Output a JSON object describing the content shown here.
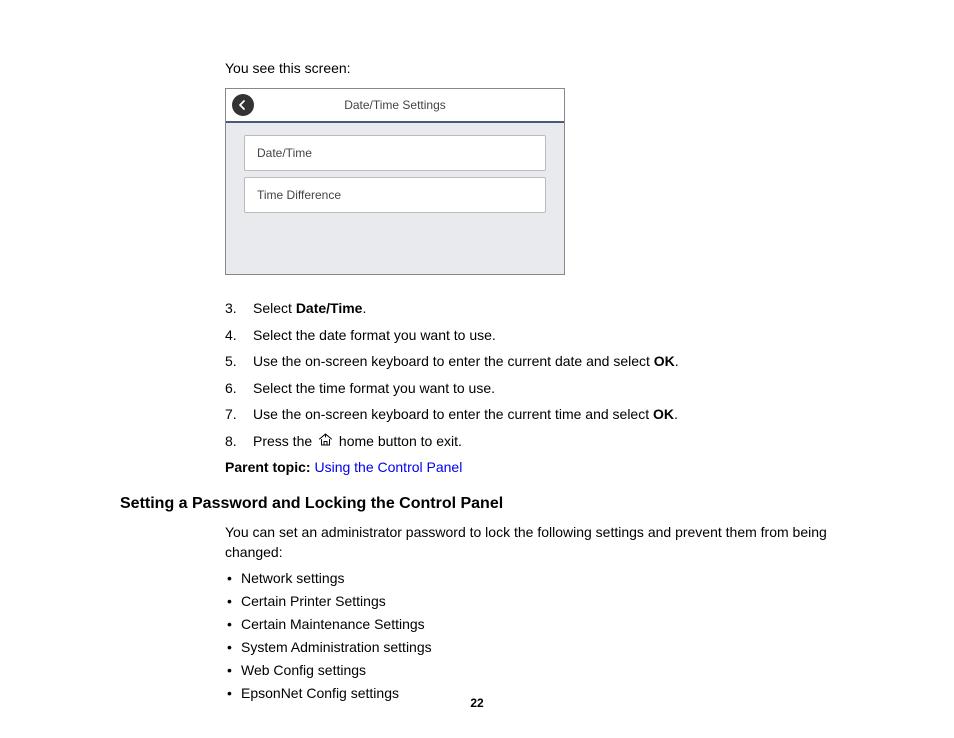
{
  "intro": "You see this screen:",
  "screen": {
    "title": "Date/Time Settings",
    "options": [
      "Date/Time",
      "Time Difference"
    ]
  },
  "steps": {
    "s3_a": "Select ",
    "s3_b": "Date/Time",
    "s3_c": ".",
    "s4": "Select the date format you want to use.",
    "s5_a": "Use the on-screen keyboard to enter the current date and select ",
    "s5_b": "OK",
    "s5_c": ".",
    "s6": "Select the time format you want to use.",
    "s7_a": "Use the on-screen keyboard to enter the current time and select ",
    "s7_b": "OK",
    "s7_c": ".",
    "s8_a": "Press the ",
    "s8_b": " home button to exit."
  },
  "parent": {
    "label": "Parent topic:",
    "link": "Using the Control Panel"
  },
  "section": {
    "heading": "Setting a Password and Locking the Control Panel",
    "para": "You can set an administrator password to lock the following settings and prevent them from being changed:",
    "bullets": [
      "Network settings",
      "Certain Printer Settings",
      "Certain Maintenance Settings",
      "System Administration settings",
      "Web Config settings",
      "EpsonNet Config settings"
    ]
  },
  "pageNumber": "22"
}
